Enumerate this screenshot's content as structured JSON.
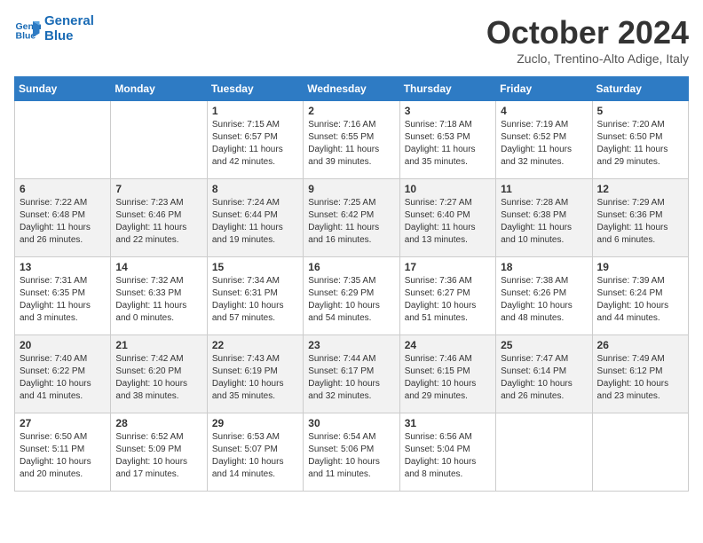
{
  "header": {
    "logo_line1": "General",
    "logo_line2": "Blue",
    "month": "October 2024",
    "location": "Zuclo, Trentino-Alto Adige, Italy"
  },
  "days_of_week": [
    "Sunday",
    "Monday",
    "Tuesday",
    "Wednesday",
    "Thursday",
    "Friday",
    "Saturday"
  ],
  "weeks": [
    [
      {
        "day": "",
        "info": ""
      },
      {
        "day": "",
        "info": ""
      },
      {
        "day": "1",
        "info": "Sunrise: 7:15 AM\nSunset: 6:57 PM\nDaylight: 11 hours and 42 minutes."
      },
      {
        "day": "2",
        "info": "Sunrise: 7:16 AM\nSunset: 6:55 PM\nDaylight: 11 hours and 39 minutes."
      },
      {
        "day": "3",
        "info": "Sunrise: 7:18 AM\nSunset: 6:53 PM\nDaylight: 11 hours and 35 minutes."
      },
      {
        "day": "4",
        "info": "Sunrise: 7:19 AM\nSunset: 6:52 PM\nDaylight: 11 hours and 32 minutes."
      },
      {
        "day": "5",
        "info": "Sunrise: 7:20 AM\nSunset: 6:50 PM\nDaylight: 11 hours and 29 minutes."
      }
    ],
    [
      {
        "day": "6",
        "info": "Sunrise: 7:22 AM\nSunset: 6:48 PM\nDaylight: 11 hours and 26 minutes."
      },
      {
        "day": "7",
        "info": "Sunrise: 7:23 AM\nSunset: 6:46 PM\nDaylight: 11 hours and 22 minutes."
      },
      {
        "day": "8",
        "info": "Sunrise: 7:24 AM\nSunset: 6:44 PM\nDaylight: 11 hours and 19 minutes."
      },
      {
        "day": "9",
        "info": "Sunrise: 7:25 AM\nSunset: 6:42 PM\nDaylight: 11 hours and 16 minutes."
      },
      {
        "day": "10",
        "info": "Sunrise: 7:27 AM\nSunset: 6:40 PM\nDaylight: 11 hours and 13 minutes."
      },
      {
        "day": "11",
        "info": "Sunrise: 7:28 AM\nSunset: 6:38 PM\nDaylight: 11 hours and 10 minutes."
      },
      {
        "day": "12",
        "info": "Sunrise: 7:29 AM\nSunset: 6:36 PM\nDaylight: 11 hours and 6 minutes."
      }
    ],
    [
      {
        "day": "13",
        "info": "Sunrise: 7:31 AM\nSunset: 6:35 PM\nDaylight: 11 hours and 3 minutes."
      },
      {
        "day": "14",
        "info": "Sunrise: 7:32 AM\nSunset: 6:33 PM\nDaylight: 11 hours and 0 minutes."
      },
      {
        "day": "15",
        "info": "Sunrise: 7:34 AM\nSunset: 6:31 PM\nDaylight: 10 hours and 57 minutes."
      },
      {
        "day": "16",
        "info": "Sunrise: 7:35 AM\nSunset: 6:29 PM\nDaylight: 10 hours and 54 minutes."
      },
      {
        "day": "17",
        "info": "Sunrise: 7:36 AM\nSunset: 6:27 PM\nDaylight: 10 hours and 51 minutes."
      },
      {
        "day": "18",
        "info": "Sunrise: 7:38 AM\nSunset: 6:26 PM\nDaylight: 10 hours and 48 minutes."
      },
      {
        "day": "19",
        "info": "Sunrise: 7:39 AM\nSunset: 6:24 PM\nDaylight: 10 hours and 44 minutes."
      }
    ],
    [
      {
        "day": "20",
        "info": "Sunrise: 7:40 AM\nSunset: 6:22 PM\nDaylight: 10 hours and 41 minutes."
      },
      {
        "day": "21",
        "info": "Sunrise: 7:42 AM\nSunset: 6:20 PM\nDaylight: 10 hours and 38 minutes."
      },
      {
        "day": "22",
        "info": "Sunrise: 7:43 AM\nSunset: 6:19 PM\nDaylight: 10 hours and 35 minutes."
      },
      {
        "day": "23",
        "info": "Sunrise: 7:44 AM\nSunset: 6:17 PM\nDaylight: 10 hours and 32 minutes."
      },
      {
        "day": "24",
        "info": "Sunrise: 7:46 AM\nSunset: 6:15 PM\nDaylight: 10 hours and 29 minutes."
      },
      {
        "day": "25",
        "info": "Sunrise: 7:47 AM\nSunset: 6:14 PM\nDaylight: 10 hours and 26 minutes."
      },
      {
        "day": "26",
        "info": "Sunrise: 7:49 AM\nSunset: 6:12 PM\nDaylight: 10 hours and 23 minutes."
      }
    ],
    [
      {
        "day": "27",
        "info": "Sunrise: 6:50 AM\nSunset: 5:11 PM\nDaylight: 10 hours and 20 minutes."
      },
      {
        "day": "28",
        "info": "Sunrise: 6:52 AM\nSunset: 5:09 PM\nDaylight: 10 hours and 17 minutes."
      },
      {
        "day": "29",
        "info": "Sunrise: 6:53 AM\nSunset: 5:07 PM\nDaylight: 10 hours and 14 minutes."
      },
      {
        "day": "30",
        "info": "Sunrise: 6:54 AM\nSunset: 5:06 PM\nDaylight: 10 hours and 11 minutes."
      },
      {
        "day": "31",
        "info": "Sunrise: 6:56 AM\nSunset: 5:04 PM\nDaylight: 10 hours and 8 minutes."
      },
      {
        "day": "",
        "info": ""
      },
      {
        "day": "",
        "info": ""
      }
    ]
  ]
}
